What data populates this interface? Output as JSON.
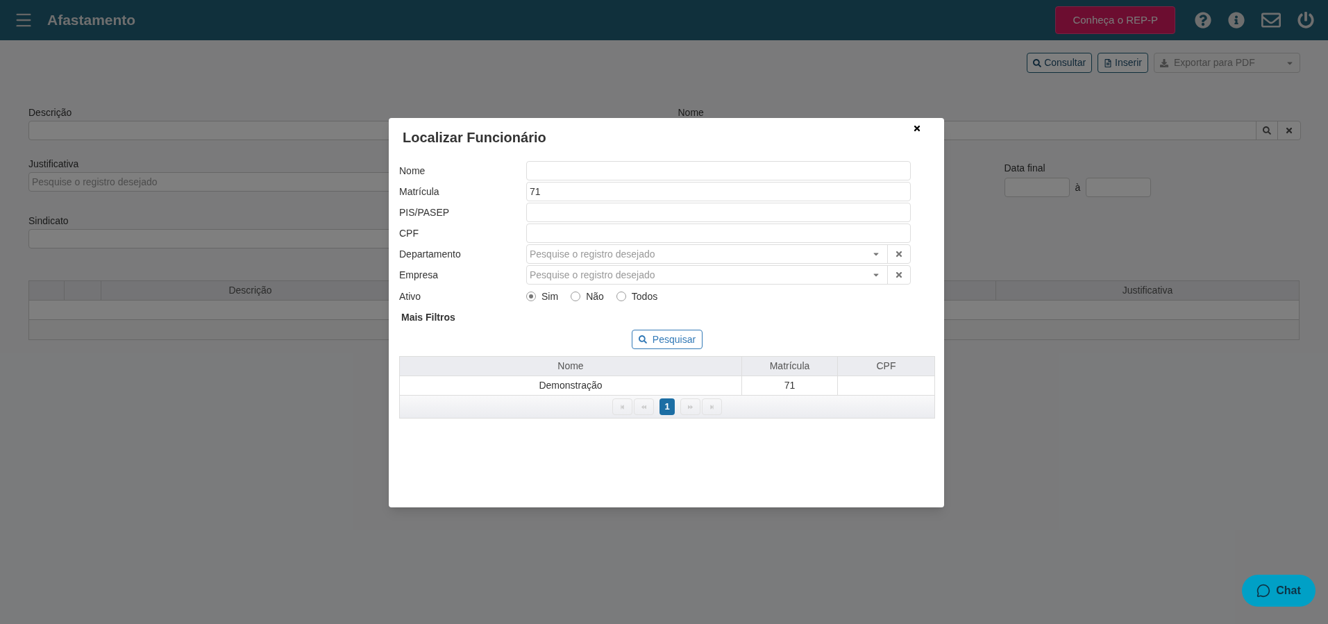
{
  "header": {
    "title": "Afastamento",
    "promo_button": "Conheça o REP-P"
  },
  "toolbar": [
    {
      "kind": "search",
      "label": "Consultar",
      "disabled": false
    },
    {
      "kind": "insert",
      "label": "Inserir",
      "disabled": false
    },
    {
      "kind": "export",
      "label": "Exportar para PDF",
      "disabled": true
    }
  ],
  "form": {
    "descricao_label": "Descrição",
    "nome_label": "Nome",
    "justificativa_label": "Justificativa",
    "justificativa_placeholder": "Pesquise o registro desejado",
    "data_final_label": "Data final",
    "date_separator": "à",
    "sindicato_label": "Sindicato"
  },
  "table": {
    "columns": [
      {
        "label": "Descrição"
      },
      {
        "label": "Justificativa"
      }
    ]
  },
  "modal": {
    "title": "Localizar Funcionário",
    "fields": [
      {
        "kind": "text",
        "label": "Nome"
      },
      {
        "kind": "text",
        "label": "Matrícula",
        "value": "71"
      },
      {
        "kind": "text",
        "label": "PIS/PASEP"
      },
      {
        "kind": "text",
        "label": "CPF"
      },
      {
        "kind": "select",
        "label": "Departamento",
        "placeholder": "Pesquise o registro desejado"
      },
      {
        "kind": "select",
        "label": "Empresa",
        "placeholder": "Pesquise o registro desejado"
      }
    ],
    "ativo": {
      "label": "Ativo",
      "options": [
        {
          "label": "Sim",
          "selected": true
        },
        {
          "label": "Não",
          "selected": false
        },
        {
          "label": "Todos",
          "selected": false
        }
      ]
    },
    "more_filters": "Mais Filtros",
    "search_button": "Pesquisar",
    "results": {
      "columns": [
        "Nome",
        "Matrícula",
        "CPF"
      ],
      "rows": [
        {
          "cells": [
            "Demonstração",
            "71"
          ],
          "selected": false
        }
      ]
    },
    "pager": {
      "nav_disabled": true,
      "pages": [
        {
          "label": "1",
          "selected": true
        }
      ]
    }
  },
  "chat": {
    "label": "Chat"
  }
}
